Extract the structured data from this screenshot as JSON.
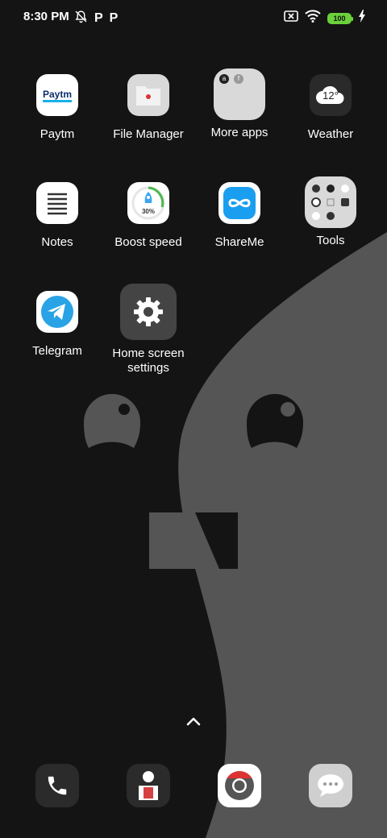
{
  "status_bar": {
    "time": "8:30 PM",
    "left_icons": [
      "bell-off-icon",
      "p-icon",
      "p-icon"
    ],
    "p_glyph": "P",
    "battery_level": "100",
    "right_icons": [
      "no-sim-icon",
      "wifi-icon",
      "battery-icon",
      "charging-icon"
    ]
  },
  "apps": [
    {
      "label": "Paytm",
      "brand": "Paytm"
    },
    {
      "label": "File Manager"
    },
    {
      "label": "More apps"
    },
    {
      "label": "Weather",
      "temp": "12°"
    },
    {
      "label": "Notes"
    },
    {
      "label": "Boost speed",
      "percent": "30%"
    },
    {
      "label": "ShareMe"
    },
    {
      "label": "Tools"
    },
    {
      "label": "Telegram"
    },
    {
      "label": "Home screen settings"
    }
  ],
  "dock": [
    "phone-icon",
    "contacts-icon",
    "chrome-icon",
    "messages-icon"
  ],
  "colors": {
    "background": "#141414",
    "wallpaper_shape": "#555555",
    "battery": "#6bd13b"
  }
}
